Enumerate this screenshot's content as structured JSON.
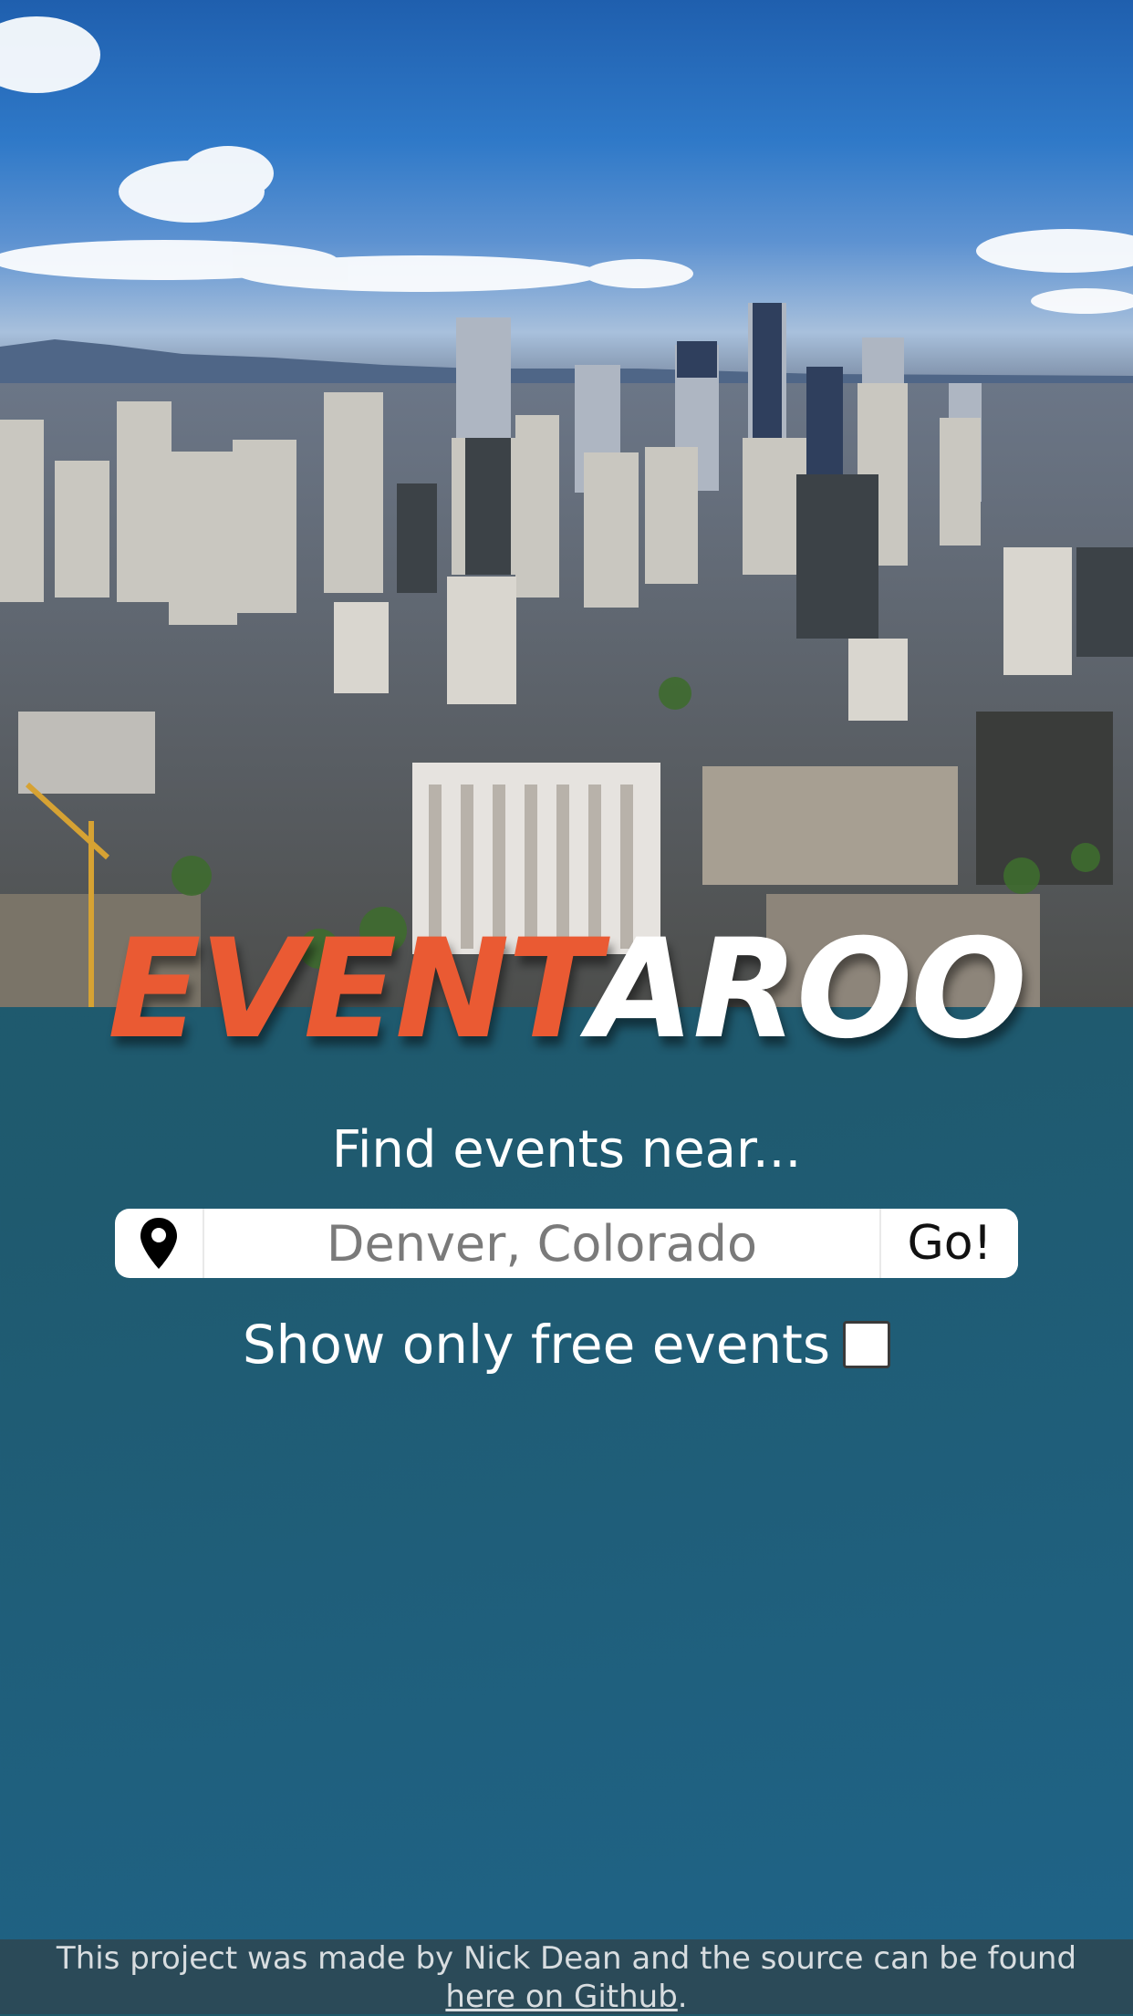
{
  "colors": {
    "logo_accent": "#ea5a33",
    "logo_light": "#ffffff",
    "background": "#1f5a6f",
    "footer_bg": "#2b4a58"
  },
  "hero": {
    "icon": "city-skyline-photo"
  },
  "logo": {
    "part_a": "EVENT",
    "part_b": "AROO"
  },
  "search": {
    "heading": "Find events near...",
    "location_icon": "map-pin-icon",
    "placeholder": "Denver, Colorado",
    "value": "",
    "button_label": "Go!"
  },
  "filter": {
    "free_label": "Show only free events",
    "free_checked": false
  },
  "footer": {
    "text": "This project was made by Nick Dean and the source can be found",
    "link_text": "here on Github",
    "trailing": "."
  }
}
